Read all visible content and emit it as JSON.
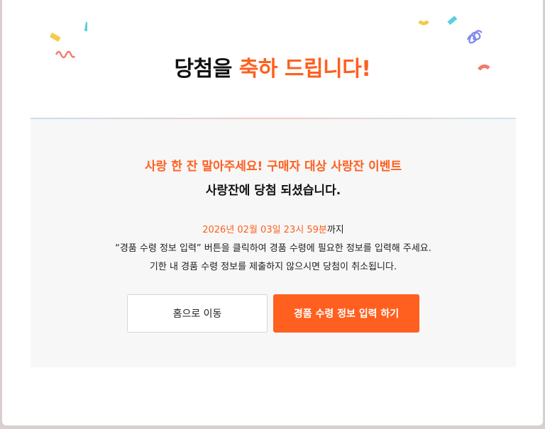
{
  "header": {
    "title_plain": "당첨을",
    "title_accent": "축하 드립니다!"
  },
  "panel": {
    "event_name": "사랑 한 잔 말아주세요! 구매자 대상 사랑잔 이벤트",
    "won_message": "사랑잔에 당첨 되셨습니다.",
    "deadline_value": "2026년 02월 03일 23시 59분",
    "deadline_suffix": "까지",
    "instruction_line1": "“경품 수령 정보 입력” 버튼을 클릭하여 경품 수령에 필요한 정보를 입력해 주세요.",
    "instruction_line2": "기한 내 경품 수령 정보를 제출하지 않으시면 당첨이 취소됩니다."
  },
  "buttons": {
    "home_label": "홈으로 이동",
    "claim_label": "경품 수령 정보 입력 하기"
  },
  "colors": {
    "accent": "#ff5f1f",
    "panel_bg": "#f7f7f7"
  },
  "icons": [
    "confetti-icon"
  ]
}
